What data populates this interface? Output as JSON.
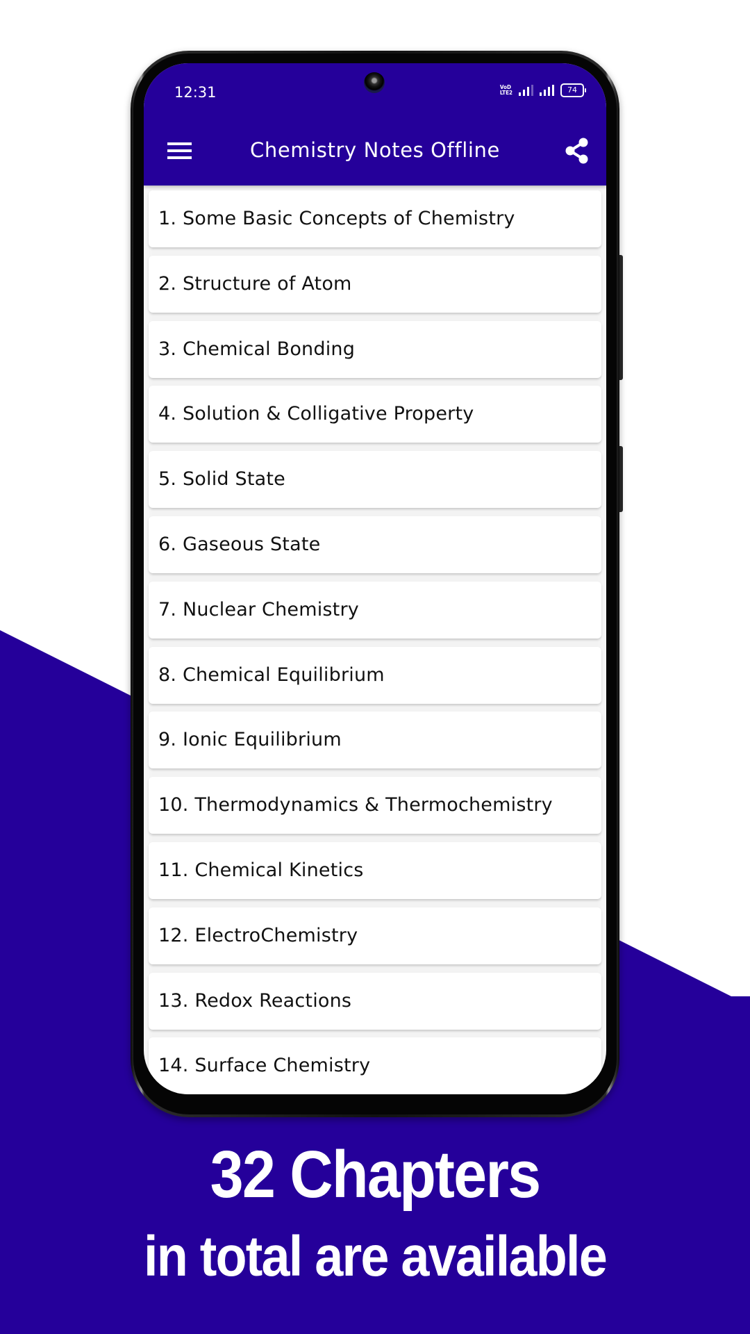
{
  "colors": {
    "brand": "#25009a",
    "background": "#ffffff",
    "card": "#ffffff",
    "card_text": "#111111"
  },
  "status_bar": {
    "time": "12:31",
    "network_label_top": "VoD",
    "network_label_bottom": "LTE2",
    "battery_level": "74",
    "icons": [
      "volte-icon",
      "signal-icon-sim1",
      "signal-icon-sim2",
      "battery-icon"
    ]
  },
  "app_bar": {
    "title": "Chemistry Notes Offline",
    "left_icon": "menu-icon",
    "right_icon": "share-icon"
  },
  "chapters": [
    {
      "label": "1. Some Basic Concepts of Chemistry"
    },
    {
      "label": "2. Structure of Atom"
    },
    {
      "label": "3. Chemical Bonding"
    },
    {
      "label": "4. Solution & Colligative Property"
    },
    {
      "label": "5. Solid State"
    },
    {
      "label": "6. Gaseous State"
    },
    {
      "label": "7. Nuclear Chemistry"
    },
    {
      "label": "8. Chemical Equilibrium"
    },
    {
      "label": "9. Ionic Equilibrium"
    },
    {
      "label": "10. Thermodynamics & Thermochemistry"
    },
    {
      "label": "11. Chemical Kinetics"
    },
    {
      "label": "12. ElectroChemistry"
    },
    {
      "label": "13. Redox Reactions"
    },
    {
      "label": "14. Surface Chemistry"
    }
  ],
  "promo": {
    "headline": "32 Chapters",
    "subheadline": "in total are available"
  }
}
